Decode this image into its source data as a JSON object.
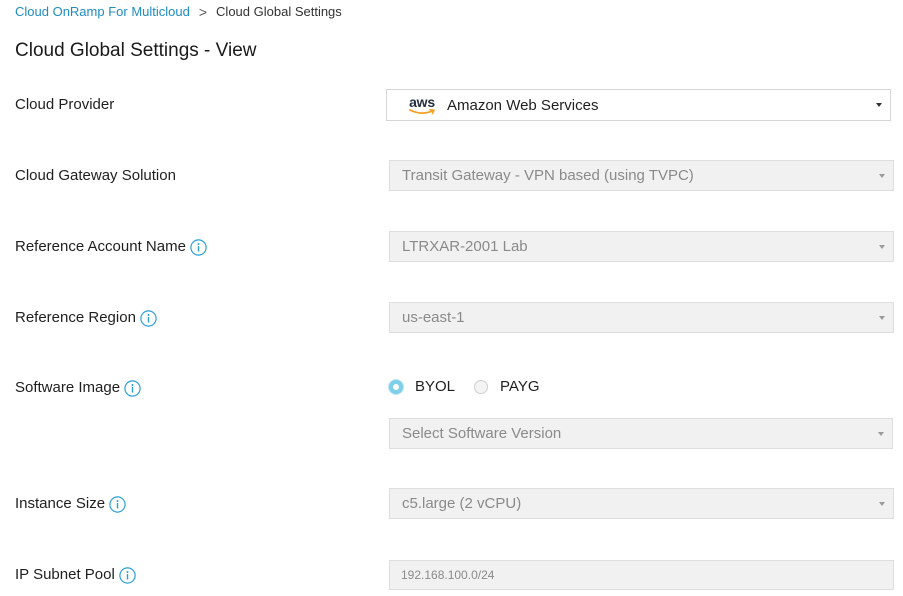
{
  "breadcrumb": {
    "parent": "Cloud OnRamp For Multicloud",
    "separator": ">",
    "current": "Cloud Global Settings"
  },
  "page_title": "Cloud Global Settings - View",
  "fields": {
    "cloud_provider": {
      "label": "Cloud Provider",
      "logo_text": "aws",
      "value": "Amazon Web Services"
    },
    "gateway_solution": {
      "label": "Cloud Gateway Solution",
      "value": "Transit Gateway - VPN based (using TVPC)"
    },
    "reference_account": {
      "label": "Reference Account Name",
      "value": "LTRXAR-2001 Lab"
    },
    "reference_region": {
      "label": "Reference Region",
      "value": "us-east-1"
    },
    "software_image": {
      "label": "Software Image",
      "options": [
        "BYOL",
        "PAYG"
      ],
      "selected": "BYOL",
      "version_placeholder": "Select Software Version"
    },
    "instance_size": {
      "label": "Instance Size",
      "value": "c5.large (2 vCPU)"
    },
    "ip_subnet_pool": {
      "label": "IP Subnet Pool",
      "value": "192.168.100.0/24"
    }
  },
  "colors": {
    "link": "#1f8dbf",
    "info_icon": "#2a9fd6",
    "radio_selected": "#7ecfe9",
    "disabled_bg": "#f1f1f1"
  },
  "icons": {
    "breadcrumb_separator": "chevron-right-icon",
    "info": "info-icon",
    "dropdown": "caret-down-icon",
    "provider_logo": "aws-logo"
  }
}
